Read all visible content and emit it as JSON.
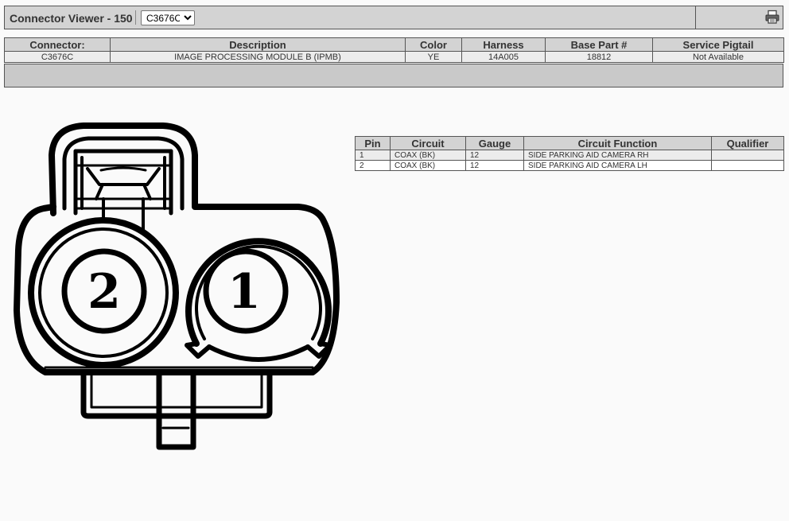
{
  "header": {
    "title": "Connector Viewer - 150",
    "selected_connector": "C3676C",
    "connector_options": [
      "C3676C"
    ],
    "print_icon": "printer-icon"
  },
  "connector_info": {
    "headers": [
      "Connector:",
      "Description",
      "Color",
      "Harness",
      "Base Part #",
      "Service Pigtail"
    ],
    "row": [
      "C3676C",
      "IMAGE PROCESSING MODULE B (IPMB)",
      "YE",
      "14A005",
      "18812",
      "Not Available"
    ]
  },
  "pin_table": {
    "headers": [
      "Pin",
      "Circuit",
      "Gauge",
      "Circuit Function",
      "Qualifier"
    ],
    "rows": [
      [
        "1",
        "COAX (BK)",
        "12",
        "SIDE PARKING AID CAMERA RH",
        ""
      ],
      [
        "2",
        "COAX (BK)",
        "12",
        "SIDE PARKING AID CAMERA LH",
        ""
      ]
    ]
  },
  "diagram": {
    "pin_labels": [
      "2",
      "1"
    ]
  }
}
